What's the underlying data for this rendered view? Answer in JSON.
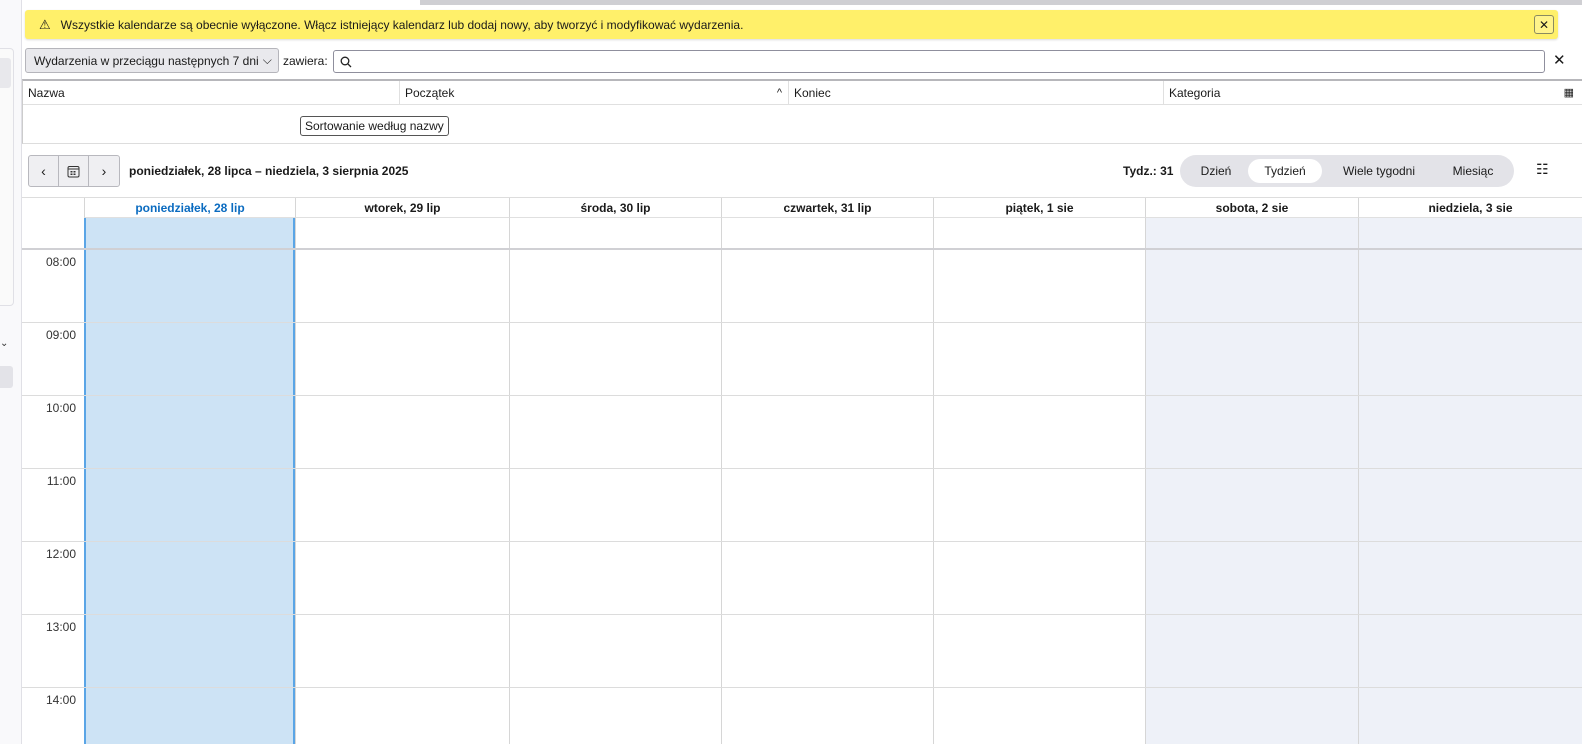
{
  "banner": {
    "message": "Wszystkie kalendarze są obecnie wyłączone. Włącz istniejący kalendarz lub dodaj nowy, aby tworzyć i modyfikować wydarzenia.",
    "warn_icon": "⚠",
    "close_icon": "✕"
  },
  "filter": {
    "selected": "Wydarzenia w przeciągu następnych 7 dni",
    "contains_label": "zawiera:",
    "search_value": "",
    "clear_icon": "✕"
  },
  "tree": {
    "columns": [
      "Nazwa",
      "Początek",
      "Koniec",
      "Kategoria"
    ],
    "sort_tooltip": "Sortowanie według nazwy"
  },
  "toolbar": {
    "range": "poniedziałek, 28 lipca – niedziela, 3 sierpnia 2025",
    "week_label": "Tydz.: 31",
    "views": [
      "Dzień",
      "Tydzień",
      "Wiele tygodni",
      "Miesiąc"
    ],
    "active_view": "Tydzień"
  },
  "calendar": {
    "days": [
      {
        "label": "poniedziałek, 28 lip",
        "today": true
      },
      {
        "label": "wtorek, 29 lip"
      },
      {
        "label": "środa, 30 lip"
      },
      {
        "label": "czwartek, 31 lip"
      },
      {
        "label": "piątek, 1 sie"
      },
      {
        "label": "sobota, 2 sie",
        "weekend": true
      },
      {
        "label": "niedziela, 3 sie",
        "weekend": true
      }
    ],
    "hours": [
      "08:00",
      "09:00",
      "10:00",
      "11:00",
      "12:00",
      "13:00",
      "14:00"
    ]
  },
  "colors": {
    "today_bg": "#cde3f5",
    "today_text": "#0a6bc0",
    "weekend_bg": "#eef1f8",
    "banner": "#fff06a"
  }
}
